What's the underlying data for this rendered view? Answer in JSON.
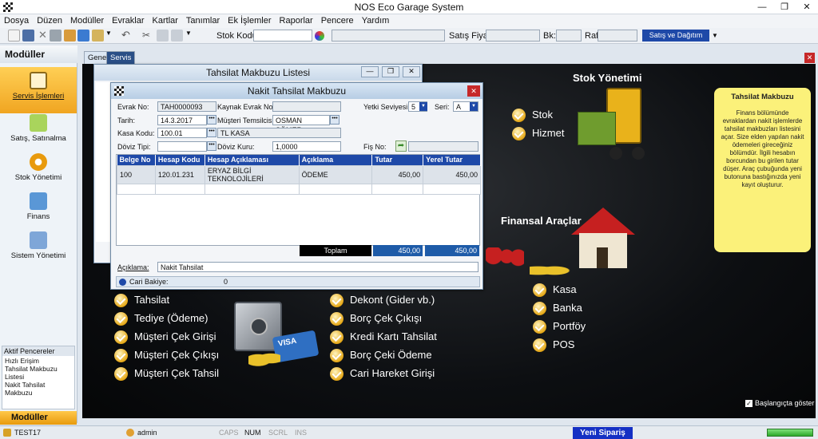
{
  "window": {
    "title": "NOS Eco Garage System"
  },
  "menu": [
    "Dosya",
    "Düzen",
    "Modüller",
    "Evraklar",
    "Kartlar",
    "Tanımlar",
    "Ek İşlemler",
    "Raporlar",
    "Pencere",
    "Yardım"
  ],
  "toolbar": {
    "stok_kodu_label": "Stok Kodu",
    "satis_fiyati_label": "Satış Fiyatı",
    "bk_label": "Bk:",
    "raf_label": "Raf",
    "satis_button": "Satış ve Dağıtım"
  },
  "leftpanel": {
    "title": "Modüller",
    "items": [
      "Servis İşlemleri",
      "Satış, Satınalma",
      "Stok Yönetimi",
      "Finans",
      "Sistem Yönetimi"
    ],
    "aktif_title": "Aktif Pencereler",
    "aktif_items": [
      "Hızlı Erişim",
      "Tahsilat Makbuzu Listesi",
      "Nakit Tahsilat Makbuzu"
    ],
    "bottom_button": "Modüller"
  },
  "tabs": [
    "Genel",
    "Servis"
  ],
  "main": {
    "stok_title": "Stok Yönetimi",
    "stok_items": [
      "Stok",
      "Hizmet"
    ],
    "finans_title": "Finansal Araçlar",
    "finans_items": [
      "Kasa",
      "Banka",
      "Portföy",
      "POS"
    ],
    "col1": [
      "Tahsilat",
      "Tediye (Ödeme)",
      "Müşteri Çek Girişi",
      "Müşteri Çek Çıkışı",
      "Müşteri Çek Tahsil"
    ],
    "col2": [
      "Dekont (Gider vb.)",
      "Borç Çek Çıkışı",
      "Kredi Kartı Tahsilat",
      "Borç Çeki Ödeme",
      "Cari Hareket Girişi"
    ],
    "startup": "Başlangıçta göster",
    "card_text": "VISA"
  },
  "note": {
    "title": "Tahsilat Makbuzu",
    "text": "Finans bölümünde evraklardan nakit işlemlerde tahsilat makbuzları listesini açar. Size elden yapılan nakit ödemeleri gireceğiniz bölümdür. İlgili hesabın borcundan bu girilen tutar düşer. Araç çubuğunda yeni butonuna bastığınızda yeni kayıt oluşturur."
  },
  "list_window": {
    "title": "Tahsilat Makbuzu Listesi"
  },
  "receipt": {
    "title": "Nakit Tahsilat Makbuzu",
    "evrak_no_label": "Evrak No:",
    "evrak_no": "TAH0000093",
    "kaynak_label": "Kaynak Evrak No:",
    "yetki_label": "Yetki Seviyesi:",
    "yetki": "5",
    "seri_label": "Seri:",
    "seri": "A",
    "tarih_label": "Tarih:",
    "tarih": "14.3.2017",
    "temsilci_label": "Müşteri Temsilcisi:",
    "temsilci": "OSMAN SÖMER",
    "kasa_label": "Kasa Kodu:",
    "kasa": "100.01",
    "kasa_name": "TL KASA",
    "doviz_label": "Döviz Tipi:",
    "kur_label": "Döviz Kuru:",
    "kur": "1,0000",
    "fis_label": "Fiş No:",
    "columns": [
      "Belge No",
      "Hesap Kodu",
      "Hesap Açıklaması",
      "Açıklama",
      "Tutar",
      "Yerel Tutar"
    ],
    "rows": [
      [
        "100",
        "120.01.231",
        "ERYAZ BİLGİ TEKNOLOJİLERİ",
        "ÖDEME",
        "450,00",
        "450,00"
      ]
    ],
    "toplam_label": "Toplam",
    "toplam": "450,00",
    "yerel_toplam": "450,00",
    "aciklama_label": "Açıklama:",
    "aciklama": "Nakit Tahsilat",
    "bakiye_label": "Cari Bakiye:",
    "bakiye": "0"
  },
  "status": {
    "db": "TEST17",
    "user": "admin",
    "keys": [
      "CAPS",
      "NUM",
      "SCRL",
      "INS"
    ],
    "yeni": "Yeni Sipariş"
  }
}
